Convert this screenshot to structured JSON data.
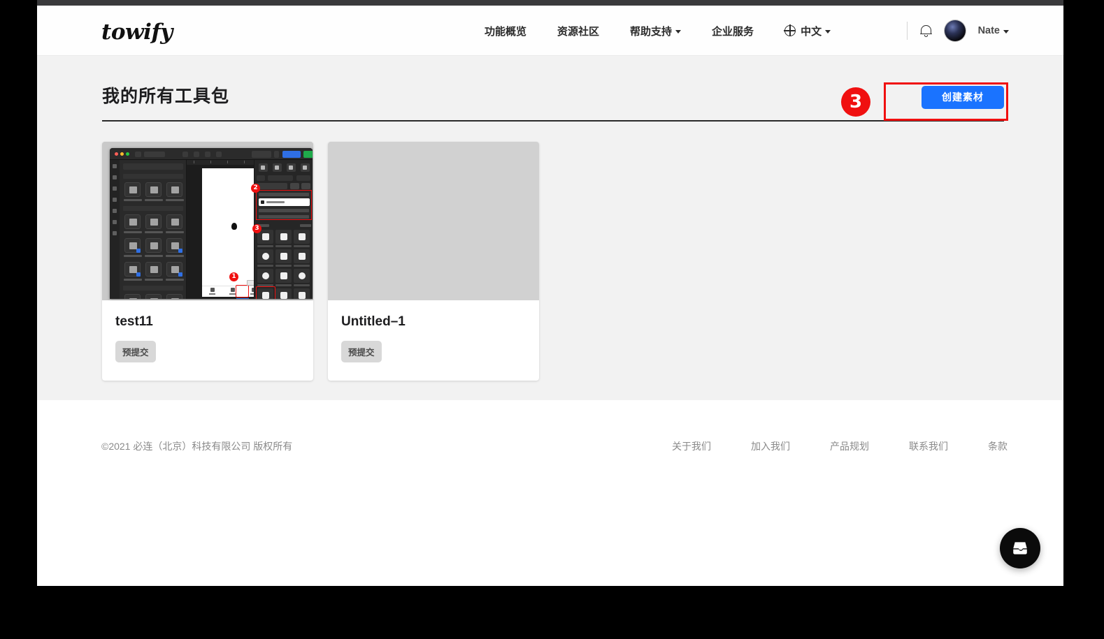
{
  "brand": {
    "logo_text": "towify"
  },
  "nav": {
    "items": [
      {
        "label": "功能概览",
        "has_caret": false
      },
      {
        "label": "资源社区",
        "has_caret": false
      },
      {
        "label": "帮助支持",
        "has_caret": true
      },
      {
        "label": "企业服务",
        "has_caret": false
      }
    ],
    "language": {
      "label": "中文",
      "icon": "globe-icon",
      "has_caret": true
    }
  },
  "header_right": {
    "notification_icon": "bell-icon",
    "avatar_icon": "user-avatar",
    "user_name": "Nate",
    "user_caret": "chevron-down-icon"
  },
  "main": {
    "page_title": "我的所有工具包",
    "create_button": "创建素材",
    "annotation_marker": "3",
    "cards": [
      {
        "title": "test11",
        "status": "预提交",
        "thumbnail": "design-editor-screenshot"
      },
      {
        "title": "Untitled–1",
        "status": "预提交",
        "thumbnail": "blank-placeholder"
      }
    ]
  },
  "thumbnail_markers": [
    "1",
    "2",
    "3"
  ],
  "footer": {
    "copyright": "©2021 必连（北京）科技有限公司 版权所有",
    "links": [
      "关于我们",
      "加入我们",
      "产品规划",
      "联系我们",
      "条款"
    ]
  },
  "chat": {
    "icon": "inbox-icon"
  },
  "colors": {
    "accent_blue": "#1a73ff",
    "annotation_red": "#f01010",
    "content_bg": "#f2f2f2",
    "badge_bg": "#d8d8d8",
    "placeholder_gray": "#d1d1d1"
  }
}
